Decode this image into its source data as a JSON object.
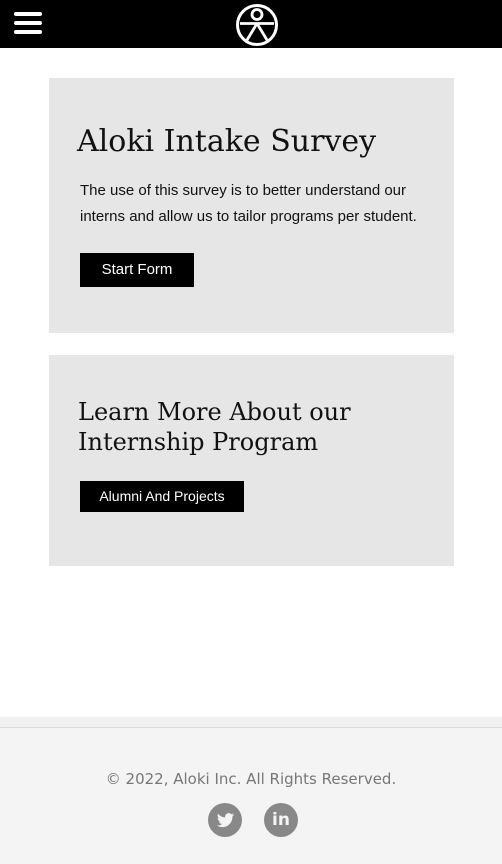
{
  "header": {
    "menu_icon": "hamburger-menu-icon",
    "logo_icon": "person-circle-logo-icon",
    "background": "#000000"
  },
  "survey_card": {
    "title": "Aloki Intake Survey",
    "description": "The use of this survey is to better understand our interns and allow us to tailor programs per student.",
    "button_label": "Start Form"
  },
  "internship_card": {
    "title": "Learn More About our Internship Program",
    "button_label": "Alumni And Projects"
  },
  "footer": {
    "copyright": "© 2022, Aloki Inc. All Rights Reserved.",
    "social": [
      {
        "icon": "twitter-icon"
      },
      {
        "icon": "linkedin-icon",
        "glyph": "in"
      }
    ]
  },
  "colors": {
    "card_background": "#e6e6e6",
    "button_background": "#000000",
    "footer_background": "#f4f4f4",
    "social_icon": "#888888"
  }
}
